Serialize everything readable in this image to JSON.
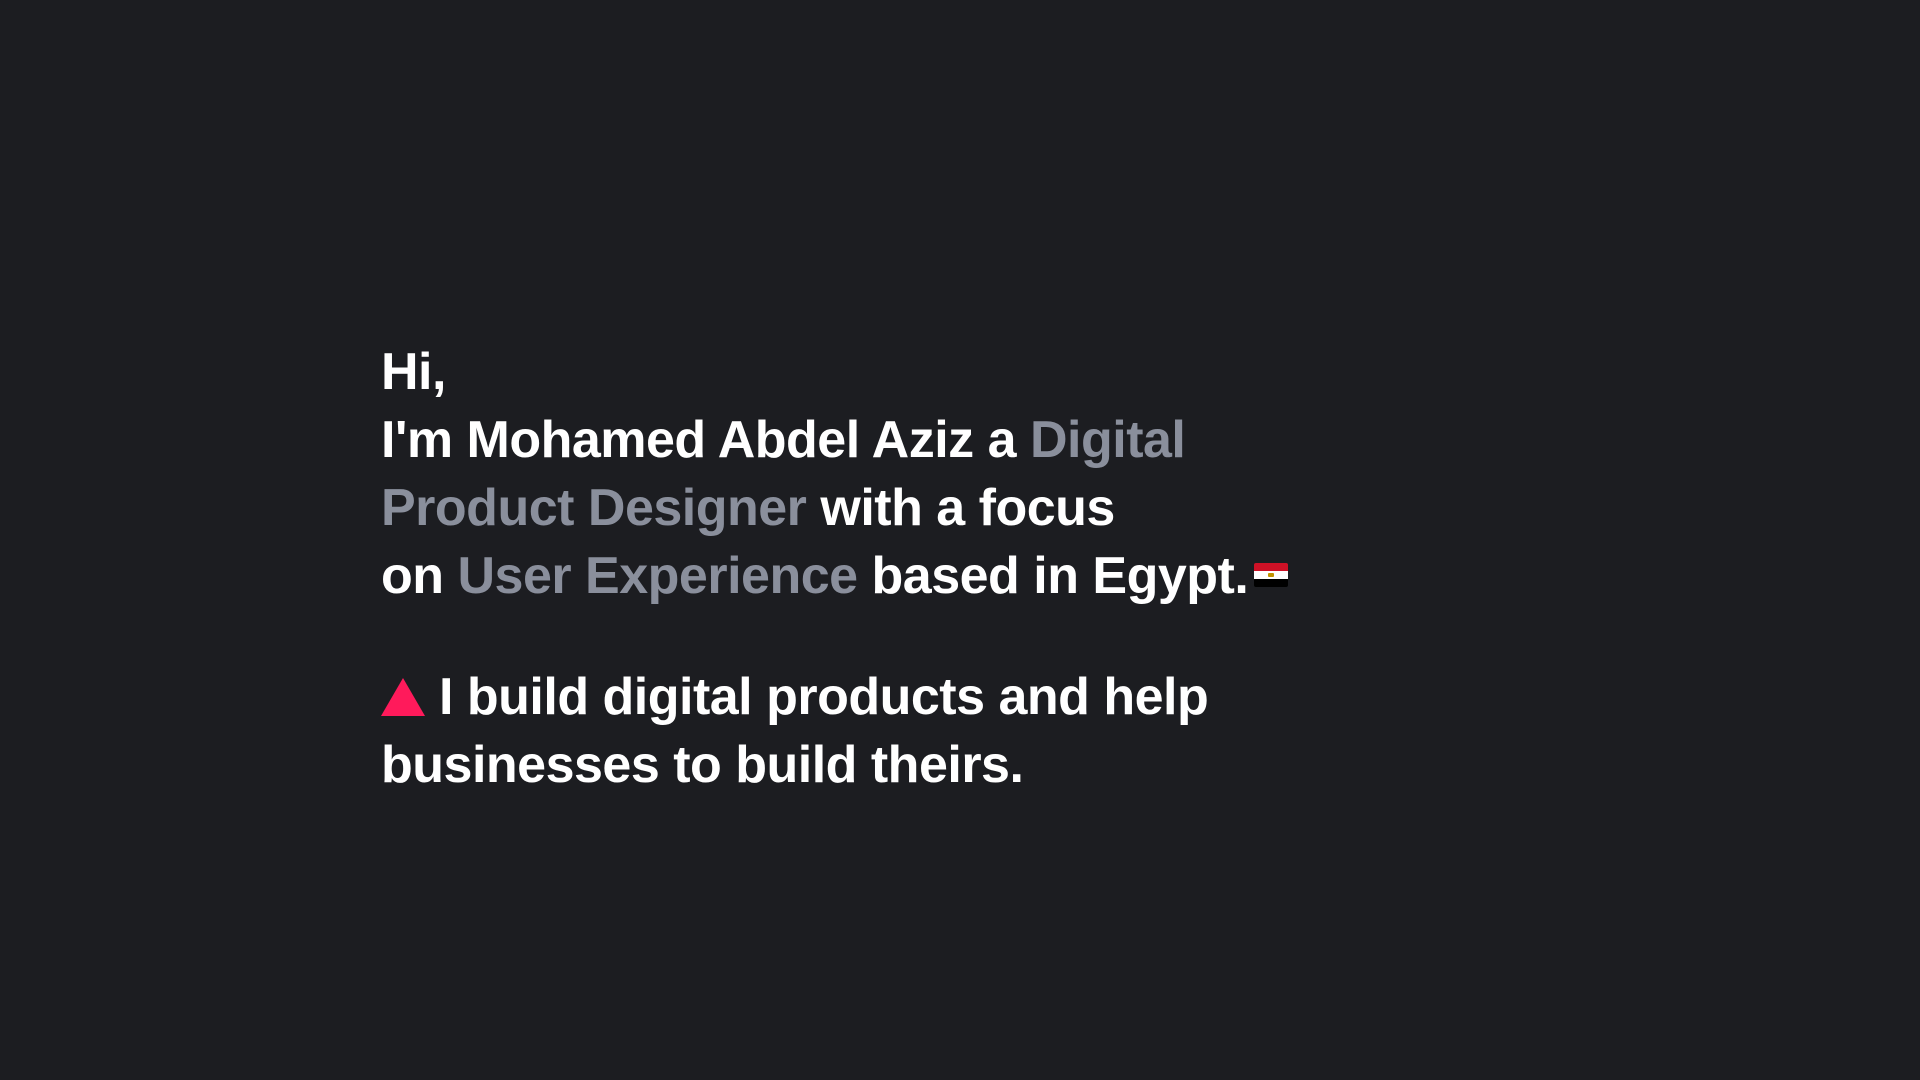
{
  "hero": {
    "greeting": "Hi,",
    "intro_prefix": "I'm Mohamed Abdel Aziz a",
    "role_part1": "Digital",
    "role_part2": "Product Designer",
    "focus_text": "with a focus",
    "on_text": "on",
    "specialty": "User Experience",
    "location_text": "based in Egypt.",
    "flag_icon": "egypt-flag-icon",
    "tagline_line1": "I build digital products and help",
    "tagline_line2": "businesses to build theirs.",
    "tagline_icon": "triangle-icon"
  },
  "colors": {
    "background": "#1c1d21",
    "text": "#ffffff",
    "muted": "#8a8f9c",
    "accent": "#ff1a5b"
  }
}
